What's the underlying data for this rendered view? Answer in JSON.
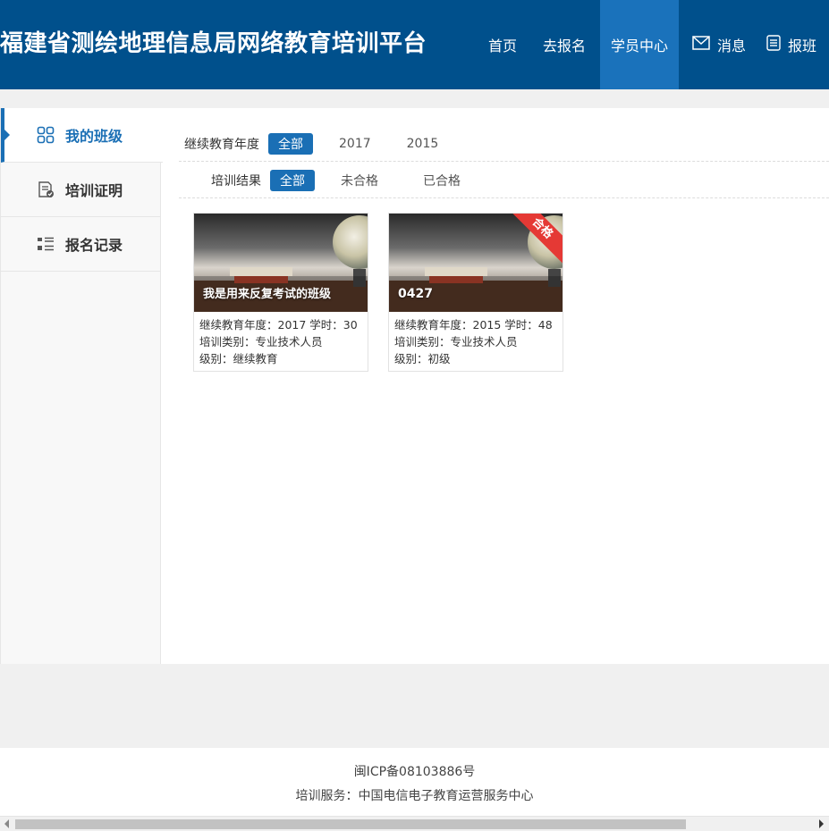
{
  "header": {
    "title": "福建省测绘地理信息局网络教育培训平台",
    "nav": [
      {
        "label": "首页",
        "active": false
      },
      {
        "label": "去报名",
        "active": false
      },
      {
        "label": "学员中心",
        "active": true
      },
      {
        "label": "消息",
        "icon": "mail-icon"
      },
      {
        "label": "报班",
        "icon": "list-icon"
      }
    ]
  },
  "sidebar": {
    "items": [
      {
        "label": "我的班级",
        "icon": "grid-icon",
        "active": true
      },
      {
        "label": "培训证明",
        "icon": "certificate-icon"
      },
      {
        "label": "报名记录",
        "icon": "list-record-icon"
      }
    ]
  },
  "filters": {
    "year": {
      "label": "继续教育年度",
      "options": [
        "全部",
        "2017",
        "2015"
      ],
      "selected": "全部"
    },
    "result": {
      "label": "培训结果",
      "options": [
        "全部",
        "未合格",
        "已合格"
      ],
      "selected": "全部"
    }
  },
  "classes": [
    {
      "title": "我是用来反复考试的班级",
      "line1": "继续教育年度：2017  学时：30",
      "line2": "培训类别：专业技术人员",
      "line3": "级别：继续教育",
      "badge": ""
    },
    {
      "title": "0427",
      "line1": "继续教育年度：2015  学时：48",
      "line2": "培训类别：专业技术人员",
      "line3": "级别：初级",
      "badge": "合格"
    }
  ],
  "footer": {
    "icp": "闽ICP备08103886号",
    "service": "培训服务：中国电信电子教育运营服务中心"
  },
  "colors": {
    "header_bg": "#00508c",
    "nav_active_bg": "#1a72bb",
    "accent": "#1a6fb5",
    "badge": "#e53935"
  }
}
